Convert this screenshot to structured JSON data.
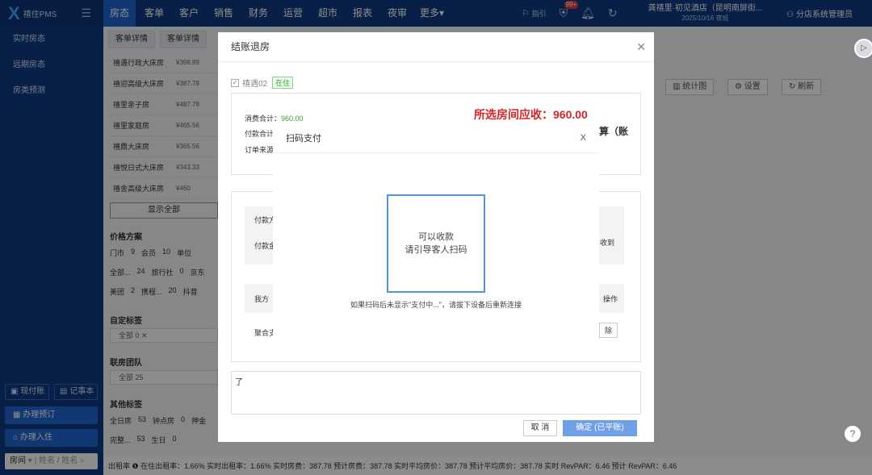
{
  "app": {
    "logo_mark": "X",
    "logo_text": "禧住PMS",
    "menu_icon": "menu-icon"
  },
  "nav": {
    "items": [
      "房态",
      "客单",
      "客户",
      "销售",
      "财务",
      "运营",
      "超市",
      "报表",
      "夜审",
      "更多▾"
    ],
    "active": 0
  },
  "topbar": {
    "guide": "指引",
    "badge": "99+",
    "hotel_name": "龚禧里·初见酒店（昆明南屏街...",
    "hotel_date": "2025/10/16 夜班",
    "user": "分店系统管理员"
  },
  "sidebar": {
    "items": [
      "实时房态",
      "远期房态",
      "房类预测"
    ],
    "cash_btn": "现付账",
    "note_btn": "记事本",
    "book_btn": "办理预订",
    "checkin_btn": "办理入住",
    "search_label": "房间",
    "search_placeholder": "姓名 / 姓名"
  },
  "main": {
    "subtabs": [
      "客单详情",
      "客单详情"
    ],
    "rooms": [
      {
        "name": "禧遇行政大床房",
        "price": "¥398.89"
      },
      {
        "name": "禧迎高级大床房",
        "price": "¥387.78"
      },
      {
        "name": "禧里亲子房",
        "price": "¥487.78"
      },
      {
        "name": "禧里家庭房",
        "price": "¥465.56"
      },
      {
        "name": "禧鼎大床房",
        "price": "¥365.56"
      },
      {
        "name": "禧悦日式大床房",
        "price": "¥343.33"
      },
      {
        "name": "禧舍高级大床房",
        "price": "¥460"
      }
    ],
    "show_all": "显示全部",
    "price_plan_title": "价格方案",
    "price_plan_row1": [
      "门市",
      "9",
      "会员",
      "10",
      "单位"
    ],
    "price_plan_row2": [
      "全部...",
      "24",
      "旅行社",
      "0",
      "京东"
    ],
    "price_plan_row3": [
      "美团",
      "2",
      "携程...",
      "20",
      "抖音"
    ],
    "custom_tag_title": "自定标签",
    "custom_tag_filter": "全部 0 ✕",
    "team_title": "联房团队",
    "team_filter": "全部 25",
    "other_tag_title": "其他标签",
    "other_row1": [
      "全日房",
      "53",
      "钟点房",
      "0",
      "押金"
    ],
    "other_row2": [
      "完整...",
      "53",
      "生日",
      "0"
    ],
    "tools": [
      "统计图",
      "设置",
      "刷新"
    ]
  },
  "statusbar": "出租率 ❶  在住出租率：1.66%   实时出租率：1.66%   实时房费：387.78   预计房费：387.78   实时平均房价：387.78   预计平均房价：387.78   实时 RevPAR：6.46   预计 RevPAR：6.46",
  "checkout": {
    "title": "结账退房",
    "room_label": "禧遇02",
    "room_status": "在住",
    "consume_label": "消费合计：",
    "consume_value": "960.00",
    "pay_label": "付款合计",
    "order_label": "订单来源",
    "due": "所选房间应收：960.00",
    "partial_text": "算（账",
    "pay_method_label": "付款方",
    "pay_amount_label": "付款金",
    "collect_text": "收到",
    "our_label": "我方",
    "op_col": "操作",
    "agg_label": "聚合支",
    "remove_btn": "除",
    "remark_value": "了",
    "cancel_btn": "取 消",
    "confirm_btn": "确定 (已平账)"
  },
  "scanpay": {
    "title": "扫码支付",
    "line1": "可以收款",
    "line2": "请引导客人扫码",
    "hint": "如果扫码后未显示\"支付中...\"，请拔下设备后重新连接"
  },
  "colors": {
    "nav_bg": "#0f3a82",
    "active": "#1f66d1",
    "due_red": "#d42424",
    "scan_border": "#4d93e8"
  }
}
